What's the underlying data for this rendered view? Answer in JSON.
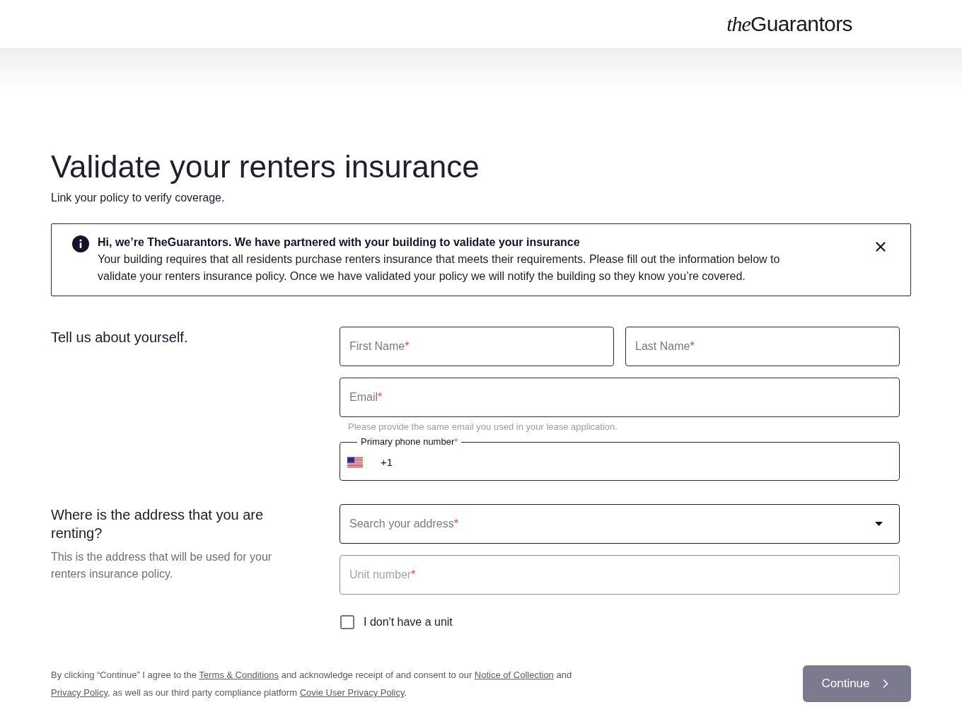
{
  "header": {
    "logo": {
      "prefix": "the",
      "name": "Guarantors"
    }
  },
  "page": {
    "title": "Validate your renters insurance",
    "subtitle": "Link your policy to verify coverage."
  },
  "alert": {
    "title": "Hi, we’re TheGuarantors. We have partnered with your building to validate your insurance",
    "body": "Your building requires that all residents purchase renters insurance that meets their requirements. Please fill out the information below to validate your renters insurance policy. Once we have validated your policy we will notify the building so they know you’re covered."
  },
  "about": {
    "heading": "Tell us about yourself.",
    "first_name": {
      "placeholder": "First Name",
      "required_mark": "*"
    },
    "last_name": {
      "placeholder": "Last Name",
      "required_mark": "*"
    },
    "email": {
      "placeholder": "Email",
      "required_mark": "*",
      "helper": "Please provide the same email you used in your lease application."
    },
    "phone": {
      "label": "Primary phone number",
      "required_mark": "*",
      "dial_code": "+1"
    }
  },
  "address": {
    "heading": "Where is the address that you are renting?",
    "description": "This is the address that will be used for your renters insurance policy.",
    "search": {
      "placeholder": "Search your address",
      "required_mark": "*",
      "disabled": false
    },
    "unit": {
      "placeholder": "Unit number",
      "required_mark": "*",
      "disabled": true
    },
    "no_unit": {
      "label": "I don't have a unit",
      "checked": false
    }
  },
  "footer": {
    "consent": [
      {
        "kind": "text",
        "text": "By clicking “Continue” I agree to the "
      },
      {
        "kind": "link",
        "text": "Terms & Conditions"
      },
      {
        "kind": "text",
        "text": " and acknowledge receipt of and consent to our "
      },
      {
        "kind": "link",
        "text": "Notice of Collection"
      },
      {
        "kind": "text",
        "text": " and "
      },
      {
        "kind": "link",
        "text": "Privacy Policy"
      },
      {
        "kind": "text",
        "text": ", as well as our third party compliance platform "
      },
      {
        "kind": "link",
        "text": "Covie User Privacy Policy"
      },
      {
        "kind": "text",
        "text": "."
      }
    ],
    "continue": {
      "label": "Continue",
      "disabled": true
    }
  }
}
